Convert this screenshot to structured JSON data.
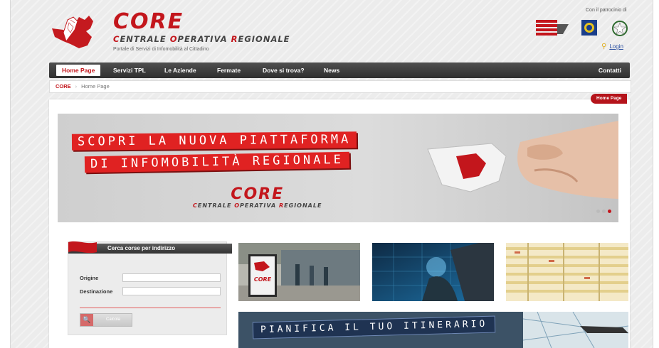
{
  "header": {
    "brand": "CORE",
    "subtitle": [
      "C",
      "ENTRALE ",
      "O",
      "PERATIVA ",
      "R",
      "EGIONALE"
    ],
    "tagline": "Portale di Servizi di Infomobilità al Cittadino",
    "patrocinio": "Con il patrocinio di",
    "login": "Login"
  },
  "nav": {
    "items": [
      "Home Page",
      "Servizi TPL",
      "Le Aziende",
      "Fermate",
      "Dove si trova?",
      "News"
    ],
    "right": "Contatti"
  },
  "breadcrumb": {
    "home": "CORE",
    "current": "Home Page"
  },
  "page_tab": "Home Page",
  "banner": {
    "line1": "SCOPRI LA NUOVA PIATTAFORMA",
    "line2": "DI INFOMOBILITÀ REGIONALE",
    "logo": "CORE",
    "logo_sub": [
      "C",
      "ENTRALE ",
      "O",
      "PERATIVA ",
      "R",
      "EGIONALE"
    ]
  },
  "search": {
    "title": "Cerca corse per indirizzo",
    "origin_label": "Origine",
    "destination_label": "Destinazione",
    "origin_value": "",
    "destination_value": "",
    "button": "Calcola"
  },
  "tiles": {
    "bus_stop_sign": "CORE",
    "plan": "PIANIFICA IL TUO ITINERARIO"
  },
  "colors": {
    "brand_red": "#c3161c",
    "nav_dark": "#3a3a3a"
  }
}
